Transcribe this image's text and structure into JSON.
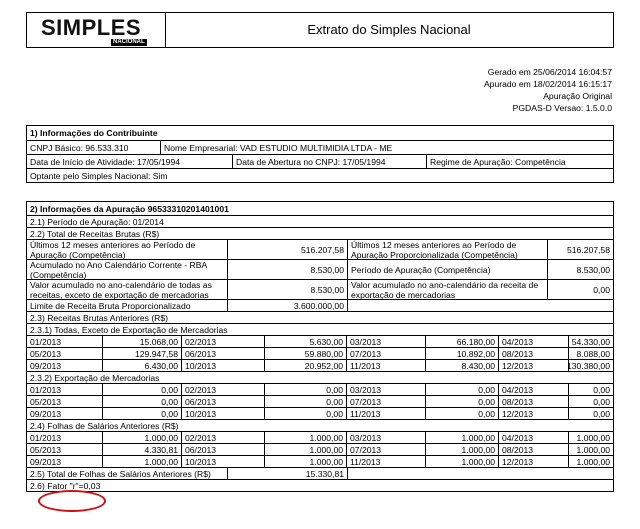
{
  "header": {
    "logo_text": "SIMPLES",
    "logo_sub": "NACIONAL",
    "title": "Extrato do Simples Nacional"
  },
  "meta": {
    "generated": "Gerado em 25/06/2014 16:04:57",
    "computed": "Apurado em 18/02/2014 16:15:17",
    "type": "Apuração Original",
    "version": "PGDAS-D Versao: 1.5.0.0"
  },
  "section1": {
    "title": "1) Informações do Contribuinte",
    "cnpj": "CNPJ Básico: 96.533.310",
    "name": "Nome Empresarial: VAD ESTUDIO MULTIMIDIA LTDA - ME",
    "start": "Data de Início de Atividade: 17/05/1994",
    "opening": "Data de Abertura no CNPJ: 17/05/1994",
    "regime": "Regime de Apuração: Competência",
    "optant": "Optante pelo Simples Nacional: Sim"
  },
  "section2": {
    "title": "2) Informações da Apuração 96533310201401001",
    "period": "2.1) Período de Apuração: 01/2014",
    "total_label": "2.2) Total de Receitas Brutas (R$)",
    "totals": [
      [
        "Últimos 12 meses anteriores ao Período de Apuração (Competência)",
        "516.207,58",
        "Últimos 12 meses anteriores ao Período de Apuração Proporcionalizada (Competência)",
        "516.207,58"
      ],
      [
        "Acumulado no Ano Calendário Corrente - RBA (Competência)",
        "8.530,00",
        "Período de Apuração (Competência)",
        "8.530,00"
      ],
      [
        "Valor acumulado no ano-calendário de todas as receitas, exceto de exportação de mercadorias",
        "8.530,00",
        "Valor acumulado no ano-calendário da receita de exportação de mercadorias",
        "0,00"
      ]
    ],
    "limit_label": "Limite de Receita Bruta Proporcionalizado",
    "limit_value": "3.600.000,00",
    "prev_label": "2.3) Receitas Brutas Anteriores  (R$)",
    "sub1_label": "2.3.1) Todas, Exceto de Exportação de Mercadorias",
    "sub1_rows": [
      [
        "01/2013",
        "15.068,00",
        "02/2013",
        "5.630,00",
        "03/2013",
        "66.180,00",
        "04/2013",
        "54.330,00"
      ],
      [
        "05/2013",
        "129.947,58",
        "06/2013",
        "59.880,00",
        "07/2013",
        "10.892,00",
        "08/2013",
        "8.088,00"
      ],
      [
        "09/2013",
        "6.430,00",
        "10/2013",
        "20.952,00",
        "11/2013",
        "8.430,00",
        "12/2013",
        "130.380,00"
      ]
    ],
    "sub2_label": "2.3.2) Exportação de Mercadorias",
    "sub2_rows": [
      [
        "01/2013",
        "0,00",
        "02/2013",
        "0,00",
        "03/2013",
        "0,00",
        "04/2013",
        "0,00"
      ],
      [
        "05/2013",
        "0,00",
        "06/2013",
        "0,00",
        "07/2013",
        "0,00",
        "08/2013",
        "0,00"
      ],
      [
        "09/2013",
        "0,00",
        "10/2013",
        "0,00",
        "11/2013",
        "0,00",
        "12/2013",
        "0,00"
      ]
    ],
    "payroll_label": "2.4) Folhas de Salários Anteriores (R$)",
    "payroll_rows": [
      [
        "01/2013",
        "1.000,00",
        "02/2013",
        "1.000,00",
        "03/2013",
        "1.000,00",
        "04/2013",
        "1.000,00"
      ],
      [
        "05/2013",
        "4.330,81",
        "06/2013",
        "1.000,00",
        "07/2013",
        "1.000,00",
        "08/2013",
        "1.000,00"
      ],
      [
        "09/2013",
        "1.000,00",
        "10/2013",
        "1.000,00",
        "11/2013",
        "1.000,00",
        "12/2013",
        "1.000,00"
      ]
    ],
    "payroll_total_label": "2.5) Total de Folhas de Salários Anteriores (R$)",
    "payroll_total_value": "15.330,81",
    "factor": "2.6) Fator \"r\"=0,03"
  },
  "colors": {
    "highlight": "#d60a12"
  }
}
